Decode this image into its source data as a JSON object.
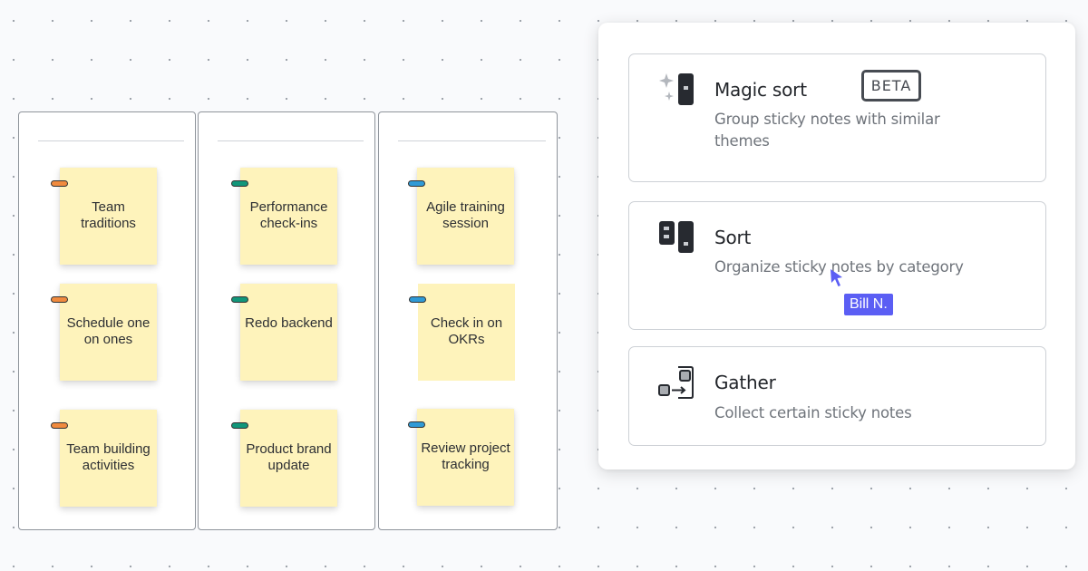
{
  "canvas": {
    "columns": [
      {
        "notes": [
          {
            "text": "Team traditions",
            "tag_color": "#f08a3e"
          },
          {
            "text": "Schedule one on ones",
            "tag_color": "#f08a3e"
          },
          {
            "text": "Team building activities",
            "tag_color": "#f08a3e"
          }
        ]
      },
      {
        "notes": [
          {
            "text": "Performance check-ins",
            "tag_color": "#11967a"
          },
          {
            "text": "Redo backend",
            "tag_color": "#11967a"
          },
          {
            "text": "Product brand update",
            "tag_color": "#11967a"
          }
        ]
      },
      {
        "notes": [
          {
            "text": "Agile training session",
            "tag_color": "#2f9ad6"
          },
          {
            "text": "Check in on OKRs",
            "tag_color": "#2f9ad6"
          },
          {
            "text": "Review project tracking",
            "tag_color": "#2f9ad6"
          }
        ]
      }
    ]
  },
  "panel": {
    "options": [
      {
        "icon": "magic-sort-icon",
        "title": "Magic sort",
        "badge": "BETA",
        "description": "Group sticky notes with similar themes"
      },
      {
        "icon": "sort-icon",
        "title": "Sort",
        "description": "Organize sticky notes by category"
      },
      {
        "icon": "gather-icon",
        "title": "Gather",
        "description": "Collect certain sticky notes"
      }
    ]
  },
  "collaborator_cursor": {
    "name": "Bill N.",
    "color": "#5b5ef4"
  },
  "colors": {
    "note_fill": "#fef3bb",
    "icon_dark": "#272a30"
  }
}
